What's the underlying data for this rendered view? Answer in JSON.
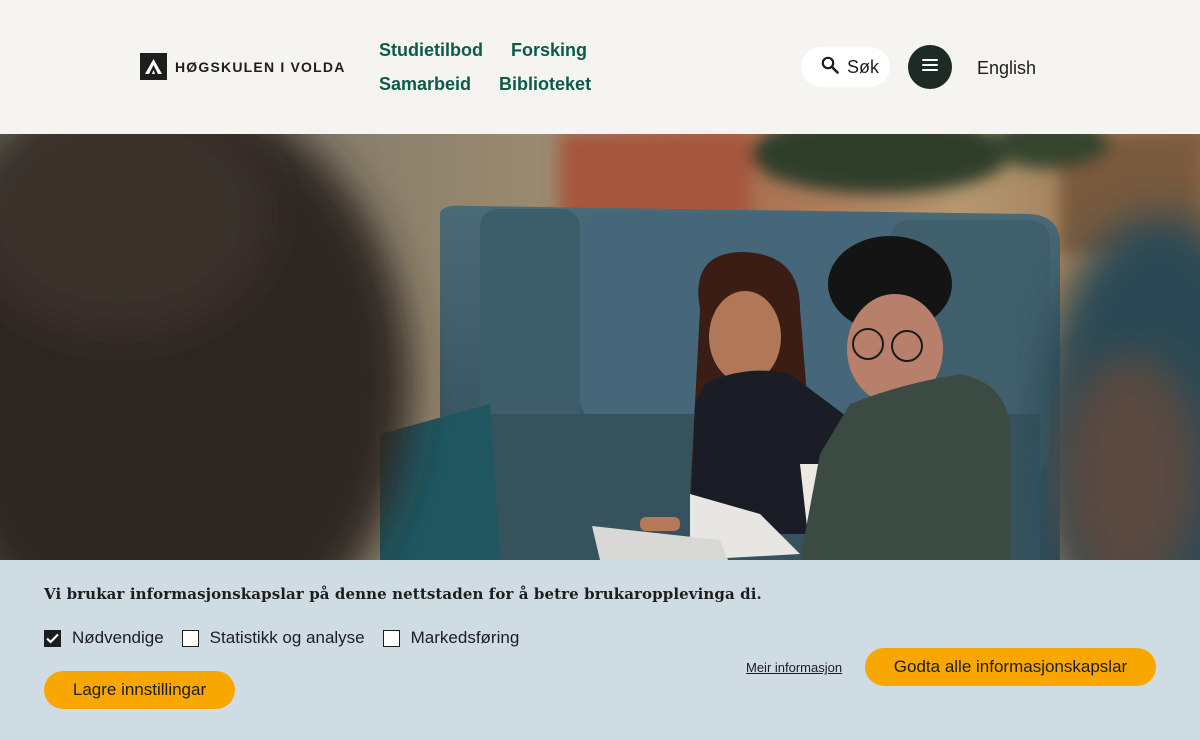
{
  "header": {
    "logo_text": "HØGSKULEN I VOLDA",
    "nav": [
      {
        "label": "Studietilbod"
      },
      {
        "label": "Forsking"
      },
      {
        "label": "Samarbeid"
      },
      {
        "label": "Biblioteket"
      }
    ],
    "search": {
      "value": "Søk",
      "icon": "search-icon"
    },
    "menu_icon": "hamburger-menu-icon",
    "language_link": "English"
  },
  "hero": {
    "image": "two-students-laptop-sofa"
  },
  "cookie_banner": {
    "message": "Vi brukar informasjonskapslar på denne nettstaden for å betre brukaropplevinga di.",
    "options": [
      {
        "label": "Nødvendige",
        "checked": true
      },
      {
        "label": "Statistikk og analyse",
        "checked": false
      },
      {
        "label": "Markedsføring",
        "checked": false
      }
    ],
    "save_button": "Lagre innstillingar",
    "more_info_link": "Meir informasjon",
    "accept_all_button": "Godta alle informasjonskapslar"
  },
  "colors": {
    "header_bg": "#f6f4f0",
    "nav_text": "#0c5a48",
    "banner_bg": "#cfdce4",
    "button_bg": "#f8a700",
    "menu_btn_bg": "#1e2a26"
  }
}
